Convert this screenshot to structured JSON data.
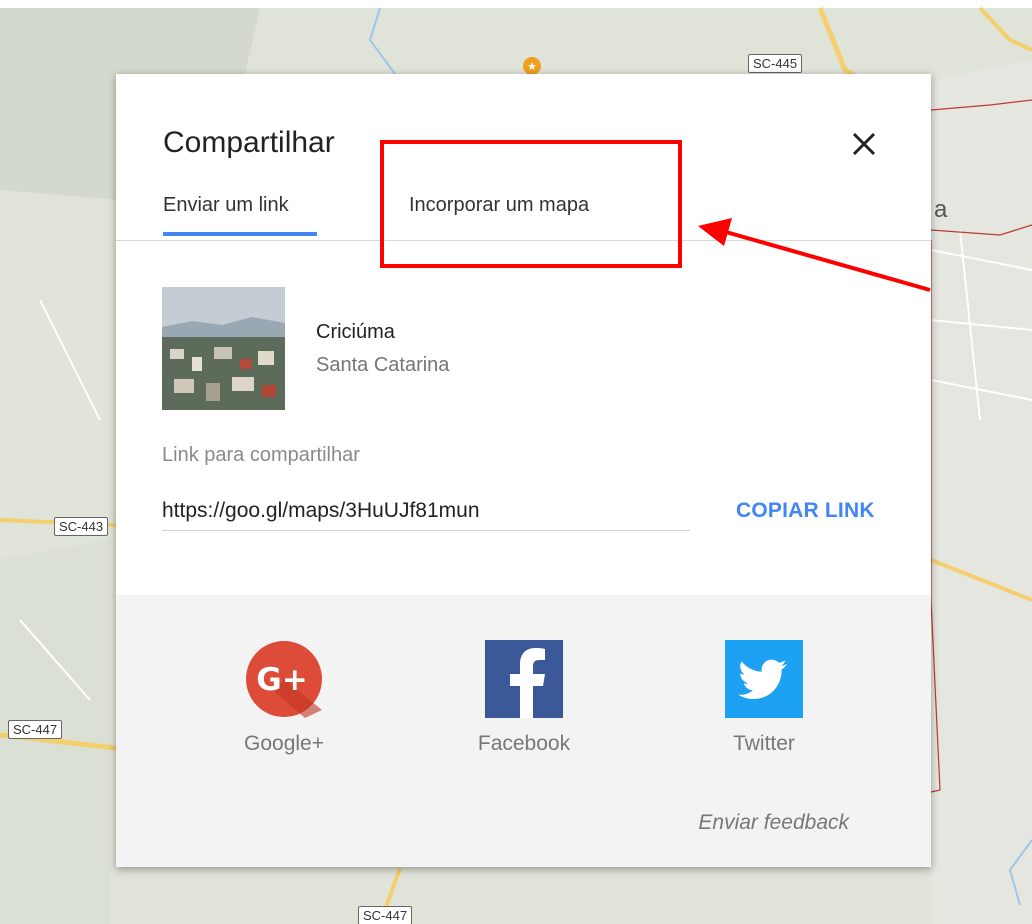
{
  "map": {
    "road_labels": [
      "SC-445",
      "SC-443",
      "SC-447",
      "SC-447"
    ],
    "partial_label": "a"
  },
  "dialog": {
    "title": "Compartilhar",
    "tabs": [
      {
        "label": "Enviar um link",
        "active": true
      },
      {
        "label": "Incorporar um mapa",
        "active": false
      }
    ],
    "place": {
      "name": "Criciúma",
      "region": "Santa Catarina"
    },
    "link": {
      "label": "Link para compartilhar",
      "value": "https://goo.gl/maps/3HuUJf81mun",
      "copy_label": "COPIAR LINK"
    },
    "share": [
      {
        "label": "Google+",
        "icon": "google-plus-icon",
        "color": "#dd4b39"
      },
      {
        "label": "Facebook",
        "icon": "facebook-icon",
        "color": "#3b5998"
      },
      {
        "label": "Twitter",
        "icon": "twitter-icon",
        "color": "#1da1f2"
      }
    ],
    "feedback_label": "Enviar feedback"
  },
  "colors": {
    "accent": "#4285f4",
    "annotation": "#ff0000"
  }
}
